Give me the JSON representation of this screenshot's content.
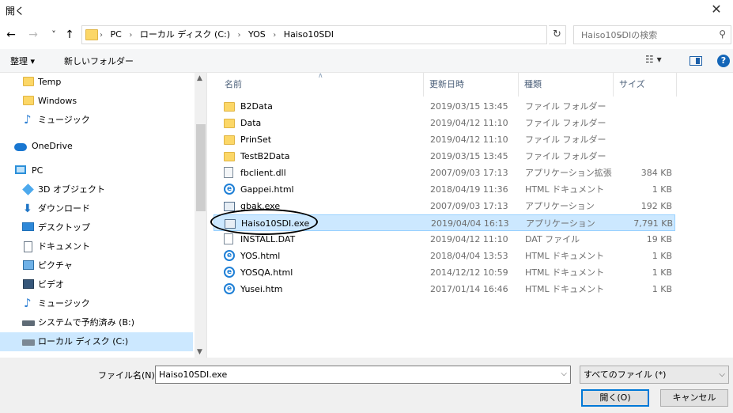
{
  "window": {
    "title": "開く",
    "close_glyph": "✕"
  },
  "nav": {
    "back_glyph": "←",
    "forward_glyph": "→",
    "recent_glyph": "˅",
    "up_glyph": "↑"
  },
  "address": {
    "crumbs": [
      "PC",
      "ローカル ディスク (C:)",
      "YOS",
      "Haiso10SDI"
    ],
    "separator": "›"
  },
  "search": {
    "placeholder": "Haiso10SDIの検索"
  },
  "toolbar": {
    "organize": "整理 ▾",
    "new_folder": "新しいフォルダー",
    "view_glyph": "☷ ▾",
    "help": "?"
  },
  "sidebar": {
    "items": [
      {
        "label": "Temp",
        "icon": "folder-icon"
      },
      {
        "label": "Windows",
        "icon": "folder-icon"
      },
      {
        "label": "ミュージック",
        "icon": "music-icon"
      },
      {
        "label": "OneDrive",
        "icon": "onedrive-icon"
      },
      {
        "label": "PC",
        "icon": "pc-icon"
      },
      {
        "label": "3D オブジェクト",
        "icon": "3d-objects-icon"
      },
      {
        "label": "ダウンロード",
        "icon": "download-icon"
      },
      {
        "label": "デスクトップ",
        "icon": "desktop-icon"
      },
      {
        "label": "ドキュメント",
        "icon": "documents-icon"
      },
      {
        "label": "ピクチャ",
        "icon": "pictures-icon"
      },
      {
        "label": "ビデオ",
        "icon": "videos-icon"
      },
      {
        "label": "ミュージック",
        "icon": "music-icon"
      },
      {
        "label": "システムで予約済み (B:)",
        "icon": "drive-icon"
      },
      {
        "label": "ローカル ディスク (C:)",
        "icon": "local-disk-icon",
        "selected": true
      }
    ]
  },
  "columns": {
    "name": "名前",
    "date": "更新日時",
    "type": "種類",
    "size": "サイズ"
  },
  "files": [
    {
      "name": "B2Data",
      "date": "2019/03/15 13:45",
      "type": "ファイル フォルダー",
      "size": "",
      "icon": "folder-icon"
    },
    {
      "name": "Data",
      "date": "2019/04/12 11:10",
      "type": "ファイル フォルダー",
      "size": "",
      "icon": "folder-icon"
    },
    {
      "name": "PrinSet",
      "date": "2019/04/12 11:10",
      "type": "ファイル フォルダー",
      "size": "",
      "icon": "folder-icon"
    },
    {
      "name": "TestB2Data",
      "date": "2019/03/15 13:45",
      "type": "ファイル フォルダー",
      "size": "",
      "icon": "folder-icon"
    },
    {
      "name": "fbclient.dll",
      "date": "2007/09/03 17:13",
      "type": "アプリケーション拡張",
      "size": "384 KB",
      "icon": "dll-file-icon"
    },
    {
      "name": "Gappei.html",
      "date": "2018/04/19 11:36",
      "type": "HTML ドキュメント",
      "size": "1 KB",
      "icon": "html-file-icon"
    },
    {
      "name": "gbak.exe",
      "date": "2007/09/03 17:13",
      "type": "アプリケーション",
      "size": "192 KB",
      "icon": "exe-file-icon"
    },
    {
      "name": "Haiso10SDI.exe",
      "date": "2019/04/04 16:13",
      "type": "アプリケーション",
      "size": "7,791 KB",
      "icon": "exe-file-icon",
      "selected": true
    },
    {
      "name": "INSTALL.DAT",
      "date": "2019/04/12 11:10",
      "type": "DAT ファイル",
      "size": "19 KB",
      "icon": "dat-file-icon"
    },
    {
      "name": "YOS.html",
      "date": "2018/04/04 13:53",
      "type": "HTML ドキュメント",
      "size": "1 KB",
      "icon": "html-file-icon"
    },
    {
      "name": "YOSQA.html",
      "date": "2014/12/12 10:59",
      "type": "HTML ドキュメント",
      "size": "1 KB",
      "icon": "html-file-icon"
    },
    {
      "name": "Yusei.htm",
      "date": "2017/01/14 16:46",
      "type": "HTML ドキュメント",
      "size": "1 KB",
      "icon": "html-file-icon"
    }
  ],
  "footer": {
    "filename_label": "ファイル名(N):",
    "filename_value": "Haiso10SDI.exe",
    "filter_value": "すべてのファイル (*)",
    "open_label": "開く(O)",
    "cancel_label": "キャンセル"
  },
  "colors": {
    "selection": "#cce8ff",
    "accent": "#0078d7"
  }
}
